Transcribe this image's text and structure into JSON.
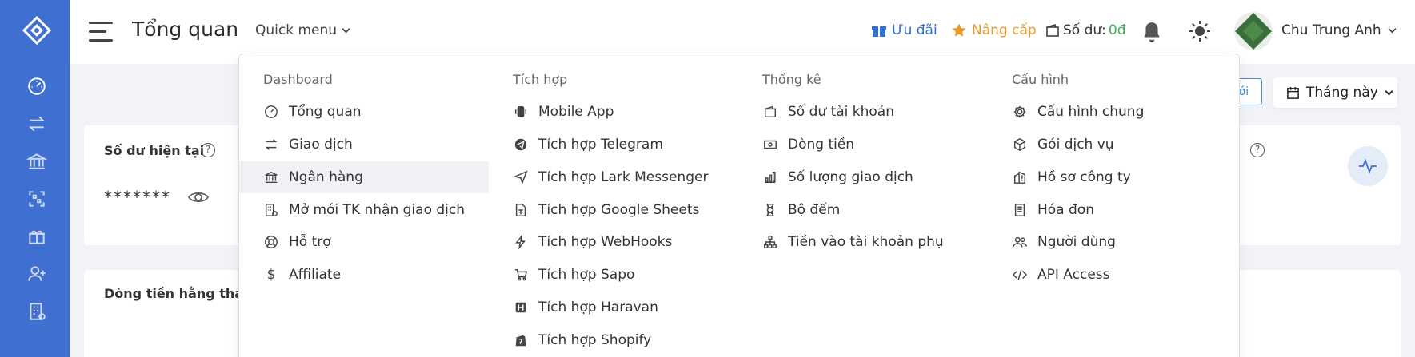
{
  "header": {
    "page_title": "Tổng quan",
    "quick_menu": "Quick menu",
    "offer": "Ưu đãi",
    "upgrade": "Nâng cấp",
    "balance_label": "Số dư:",
    "balance_value": "0đ",
    "user_name": "Chu Trung Anh"
  },
  "colors": {
    "sidebar": "#3f6fd1",
    "offer": "#2f6fd0",
    "upgrade": "#e89a2a",
    "balance_value": "#3fae5b"
  },
  "toolbar": {
    "new_label": "mới",
    "month_label": "Tháng này"
  },
  "cards": {
    "balance_title": "Số dư hiện tại",
    "balance_masked": "*******",
    "cashflow_title": "Dòng tiền hằng tháng"
  },
  "quick_menu": {
    "columns": [
      {
        "title": "Dashboard",
        "items": [
          {
            "label": "Tổng quan",
            "icon": "gauge-icon"
          },
          {
            "label": "Giao dịch",
            "icon": "swap-icon"
          },
          {
            "label": "Ngân hàng",
            "icon": "bank-icon"
          },
          {
            "label": "Mở mới TK nhận giao dịch",
            "icon": "building-plus-icon"
          },
          {
            "label": "Hỗ trợ",
            "icon": "lifebuoy-icon"
          },
          {
            "label": "Affiliate",
            "icon": "dollar-icon"
          }
        ]
      },
      {
        "title": "Tích hợp",
        "items": [
          {
            "label": "Mobile App",
            "icon": "mobile-app-icon"
          },
          {
            "label": "Tích hợp Telegram",
            "icon": "telegram-icon"
          },
          {
            "label": "Tích hợp Lark Messenger",
            "icon": "send-icon"
          },
          {
            "label": "Tích hợp Google Sheets",
            "icon": "sheet-icon"
          },
          {
            "label": "Tích hợp WebHooks",
            "icon": "lightning-icon"
          },
          {
            "label": "Tích hợp Sapo",
            "icon": "cart-icon"
          },
          {
            "label": "Tích hợp Haravan",
            "icon": "haravan-icon"
          },
          {
            "label": "Tích hợp Shopify",
            "icon": "shopify-icon"
          }
        ]
      },
      {
        "title": "Thống kê",
        "items": [
          {
            "label": "Số dư tài khoản",
            "icon": "wallet-icon"
          },
          {
            "label": "Dòng tiền",
            "icon": "cash-icon"
          },
          {
            "label": "Số lượng giao dịch",
            "icon": "bars-icon"
          },
          {
            "label": "Bộ đếm",
            "icon": "hourglass-icon"
          },
          {
            "label": "Tiền vào tài khoản phụ",
            "icon": "tree-icon"
          }
        ]
      },
      {
        "title": "Cấu hình",
        "items": [
          {
            "label": "Cấu hình chung",
            "icon": "gear-icon"
          },
          {
            "label": "Gói dịch vụ",
            "icon": "box-icon"
          },
          {
            "label": "Hồ sơ công ty",
            "icon": "company-icon"
          },
          {
            "label": "Hóa đơn",
            "icon": "invoice-icon"
          },
          {
            "label": "Người dùng",
            "icon": "users-icon"
          },
          {
            "label": "API Access",
            "icon": "code-icon"
          }
        ]
      }
    ]
  }
}
